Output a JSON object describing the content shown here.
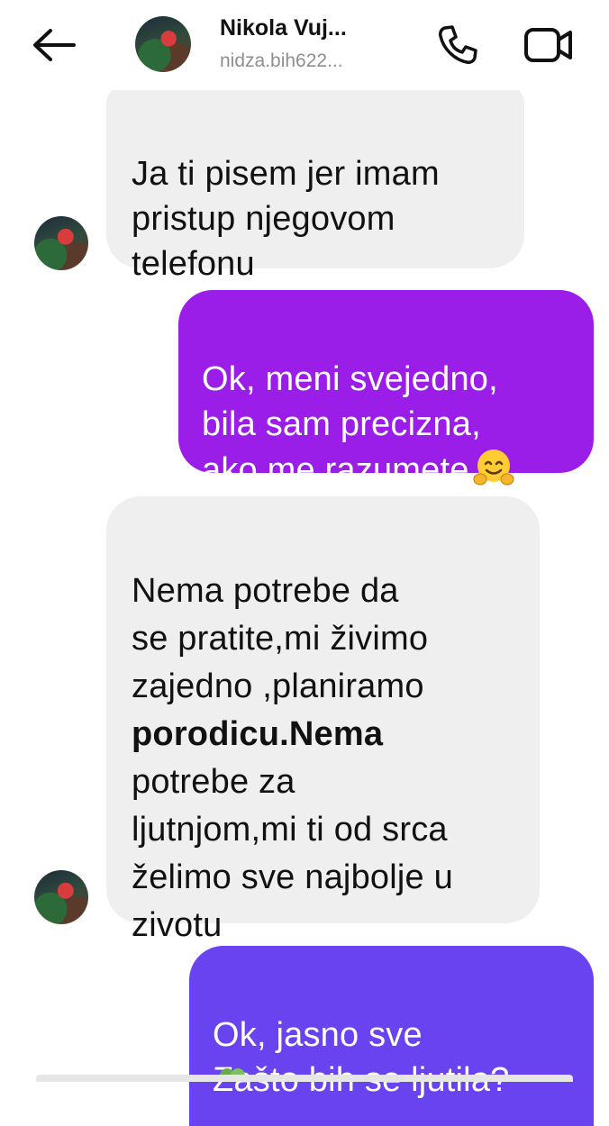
{
  "header": {
    "name": "Nikola Vuj...",
    "username": "nidza.bih622...",
    "back_icon": "arrow-left-icon",
    "call_icon": "phone-icon",
    "video_icon": "video-camera-icon"
  },
  "messages": [
    {
      "direction": "received",
      "text": "Ja ti pisem jer imam\npristup njegovom\ntelefonu"
    },
    {
      "direction": "sent",
      "text": "Ok, meni svejedno,\nbila sam precizna,\nako me razumete",
      "emoji": "hugging-face-emoji"
    },
    {
      "direction": "received",
      "text_before": "Nema potrebe da\nse pratite,mi živimo\nzajedno ,planiramo\n",
      "text_bold": "porodicu.Nema",
      "text_after": "\npotrebe za\nljutnjom,mi ti od srca\nželimo sve najbolje u\nzivotu"
    },
    {
      "direction": "sent",
      "text": "Ok, jasno sve\nZašto bih se ljutila?",
      "emoji": "clover-emoji"
    }
  ],
  "colors": {
    "received_bubble": "#efefef",
    "sent_bubble_purple": "#9b1ee8",
    "sent_bubble_indigo": "#6a43f0",
    "username_gray": "#8e8e8e"
  }
}
